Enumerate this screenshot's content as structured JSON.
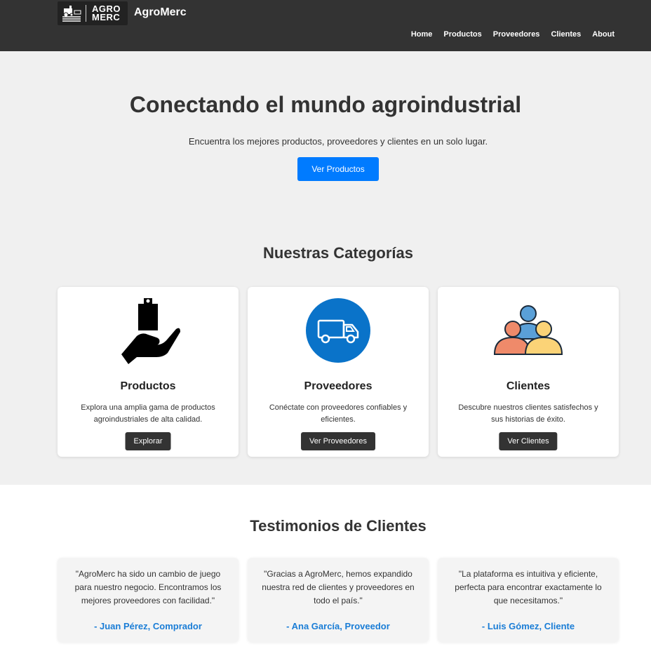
{
  "header": {
    "logo_text_line1": "AGRO",
    "logo_text_line2": "MERC",
    "brand": "AgroMerc",
    "nav": [
      "Home",
      "Productos",
      "Proveedores",
      "Clientes",
      "About"
    ]
  },
  "hero": {
    "title": "Conectando el mundo agroindustrial",
    "subtitle": "Encuentra los mejores productos, proveedores y clientes en un solo lugar.",
    "cta_label": "Ver Productos",
    "cta_color": "#007bff"
  },
  "categories": {
    "title": "Nuestras Categorías",
    "items": [
      {
        "title": "Productos",
        "description": "Explora una amplia gama de productos agroindustriales de alta calidad.",
        "button": "Explorar",
        "icon": "hand-bag-icon"
      },
      {
        "title": "Proveedores",
        "description": "Conéctate con proveedores confiables y eficientes.",
        "button": "Ver Proveedores",
        "icon": "truck-icon"
      },
      {
        "title": "Clientes",
        "description": "Descubre nuestros clientes satisfechos y sus historias de éxito.",
        "button": "Ver Clientes",
        "icon": "users-group-icon"
      }
    ]
  },
  "testimonials": {
    "title": "Testimonios de Clientes",
    "items": [
      {
        "quote": "\"AgroMerc ha sido un cambio de juego para nuestro negocio. Encontramos los mejores proveedores con facilidad.\"",
        "author": "- Juan Pérez, Comprador"
      },
      {
        "quote": "\"Gracias a AgroMerc, hemos expandido nuestra red de clientes y proveedores en todo el país.\"",
        "author": "- Ana García, Proveedor"
      },
      {
        "quote": "\"La plataforma es intuitiva y eficiente, perfecta para encontrar exactamente lo que necesitamos.\"",
        "author": "- Luis Gómez, Cliente"
      }
    ]
  }
}
